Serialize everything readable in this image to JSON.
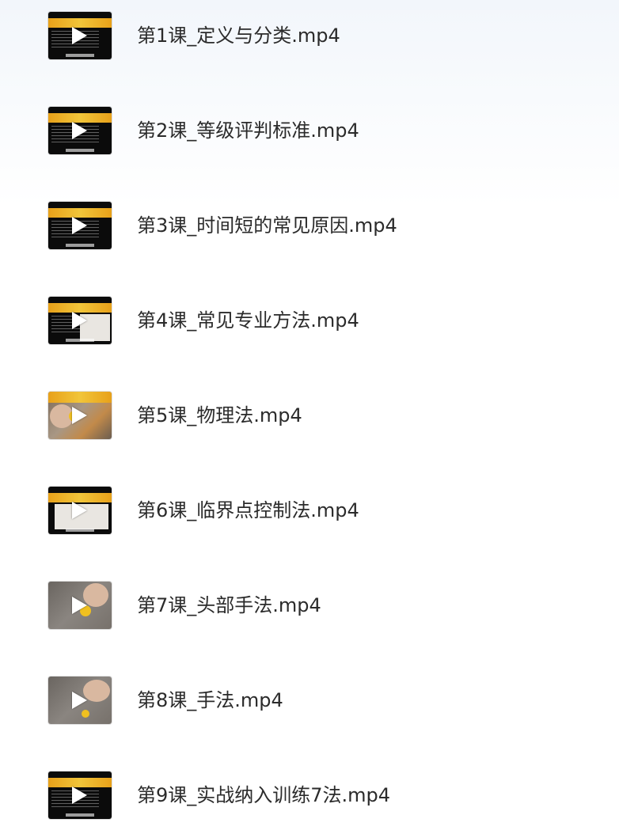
{
  "files": [
    {
      "name": "第1课_定义与分类.mp4",
      "thumbnail": "video-thumbnail",
      "icon": "play-icon"
    },
    {
      "name": "第2课_等级评判标准.mp4",
      "thumbnail": "video-thumbnail",
      "icon": "play-icon"
    },
    {
      "name": "第3课_时间短的常见原因.mp4",
      "thumbnail": "video-thumbnail",
      "icon": "play-icon"
    },
    {
      "name": "第4课_常见专业方法.mp4",
      "thumbnail": "video-thumbnail",
      "icon": "play-icon"
    },
    {
      "name": "第5课_物理法.mp4",
      "thumbnail": "video-thumbnail",
      "icon": "play-icon"
    },
    {
      "name": "第6课_临界点控制法.mp4",
      "thumbnail": "video-thumbnail",
      "icon": "play-icon"
    },
    {
      "name": "第7课_头部手法.mp4",
      "thumbnail": "video-thumbnail",
      "icon": "play-icon"
    },
    {
      "name": "第8课_手法.mp4",
      "thumbnail": "video-thumbnail",
      "icon": "play-icon"
    },
    {
      "name": "第9课_实战纳入训练7法.mp4",
      "thumbnail": "video-thumbnail",
      "icon": "play-icon"
    }
  ]
}
